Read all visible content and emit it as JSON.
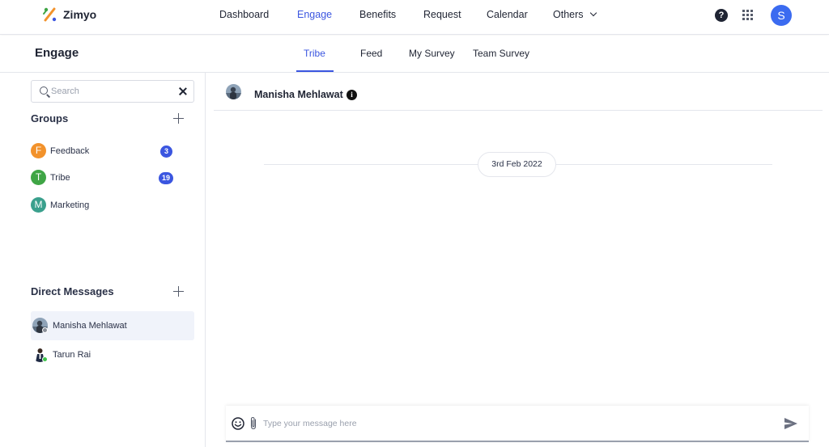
{
  "app": {
    "name": "Zimyo"
  },
  "nav": {
    "items": [
      {
        "label": "Dashboard",
        "active": false
      },
      {
        "label": "Engage",
        "active": true
      },
      {
        "label": "Benefits",
        "active": false
      },
      {
        "label": "Request",
        "active": false
      },
      {
        "label": "Calendar",
        "active": false
      },
      {
        "label": "Others",
        "active": false
      }
    ],
    "help_glyph": "?",
    "user_initial": "S"
  },
  "page": {
    "title": "Engage",
    "tabs": [
      {
        "label": "Tribe",
        "active": true
      },
      {
        "label": "Feed",
        "active": false
      },
      {
        "label": "My Survey",
        "active": false
      },
      {
        "label": "Team Survey",
        "active": false
      }
    ]
  },
  "sidebar": {
    "search": {
      "placeholder": "Search",
      "value": ""
    },
    "groups_title": "Groups",
    "groups": [
      {
        "initial": "F",
        "label": "Feedback",
        "badge": "3",
        "color": "#f2922b"
      },
      {
        "initial": "T",
        "label": "Tribe",
        "badge": "19",
        "color": "#3fa545"
      },
      {
        "initial": "M",
        "label": "Marketing",
        "badge": "",
        "color": "#3aa08d"
      }
    ],
    "dm_title": "Direct Messages",
    "direct_messages": [
      {
        "label": "Manisha Mehlawat",
        "status": "offline",
        "selected": true
      },
      {
        "label": "Tarun Rai",
        "status": "online",
        "selected": false
      }
    ]
  },
  "chat": {
    "contact_name": "Manisha Mehlawat",
    "info_glyph": "i",
    "date_divider": "3rd Feb 2022",
    "composer": {
      "placeholder": "Type your message here",
      "value": ""
    }
  },
  "colors": {
    "accent": "#3b56e0",
    "online": "#3fc44a",
    "offline": "#8a8f99"
  }
}
